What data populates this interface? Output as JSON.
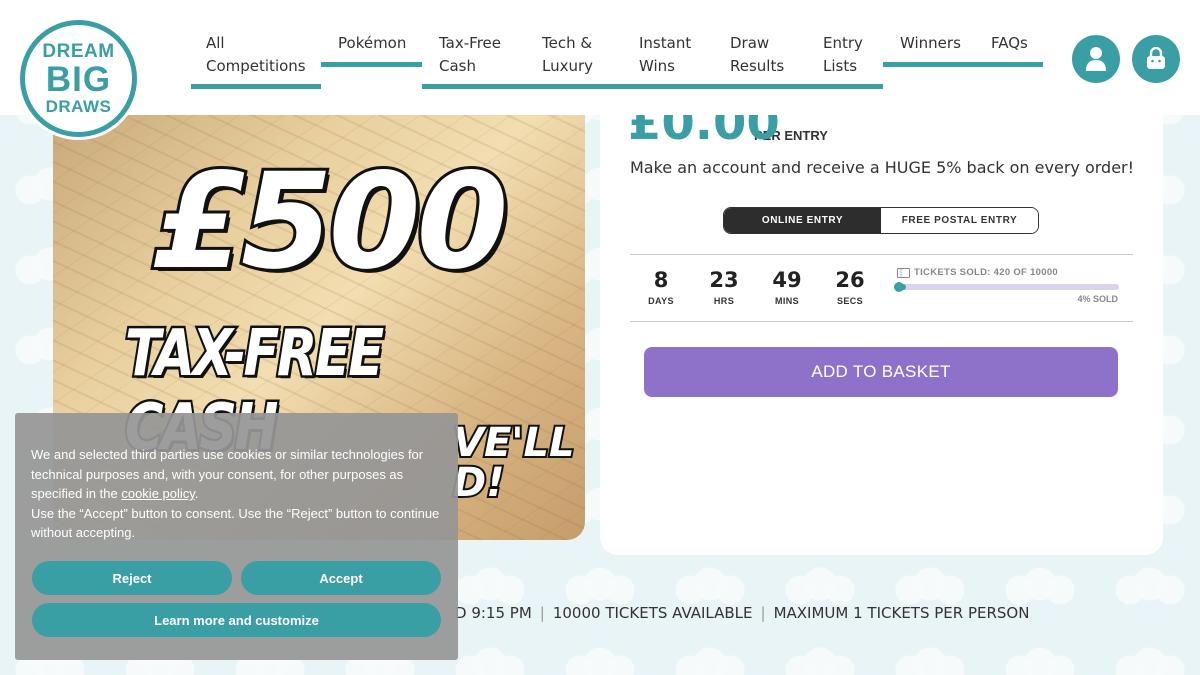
{
  "brand": {
    "line1": "DREAM",
    "line2": "BIG",
    "line3": "DRAWS"
  },
  "nav": {
    "items": [
      {
        "line1": "All",
        "line2": "Competitions"
      },
      {
        "line1": "Pokémon",
        "line2": ""
      },
      {
        "line1": "Tax-Free",
        "line2": "Cash"
      },
      {
        "line1": "Tech &",
        "line2": "Luxury"
      },
      {
        "line1": "Instant",
        "line2": "Wins"
      },
      {
        "line1": "Draw",
        "line2": "Results"
      },
      {
        "line1": "Entry",
        "line2": "Lists"
      },
      {
        "line1": "Winners",
        "line2": ""
      },
      {
        "line1": "FAQs",
        "line2": ""
      }
    ],
    "account_icon": "user-icon",
    "basket_icon": "shopping-bag-icon"
  },
  "product_image": {
    "amount": "£500",
    "caption": "TAX-FREE CASH",
    "partial_text_1": "VE'LL",
    "partial_text_2": "D!"
  },
  "product": {
    "price": "£0.00",
    "price_suffix": "PER ENTRY",
    "promo": "Make an account and receive a HUGE 5% back on every order!",
    "entry_tabs": {
      "online": "ONLINE ENTRY",
      "postal": "FREE POSTAL ENTRY"
    },
    "countdown": [
      {
        "value": "8",
        "unit": "DAYS"
      },
      {
        "value": "23",
        "unit": "HRS"
      },
      {
        "value": "49",
        "unit": "MINS"
      },
      {
        "value": "26",
        "unit": "SECS"
      }
    ],
    "tickets_sold_label": "TICKETS SOLD: 420 OF 10000",
    "sold_fraction": 0.042,
    "sold_pct_label": "4% SOLD",
    "add_to_basket": "ADD TO BASKET"
  },
  "info_line": {
    "draw_time": "D 9:15 PM",
    "tickets_available": "10000 TICKETS AVAILABLE",
    "max_per_person": "MAXIMUM 1 TICKETS PER PERSON"
  },
  "cookie_banner": {
    "text_before_link": "We and selected third parties use cookies or similar technologies for technical purposes and, with your consent, for other purposes as specified in the ",
    "link_text": "cookie policy",
    "text_after_link": ".",
    "line2": "Use the “Accept” button to consent. Use the “Reject” button to continue without accepting.",
    "reject": "Reject",
    "accept": "Accept",
    "learn_more": "Learn more and customize"
  },
  "colors": {
    "teal": "#3a9ea5",
    "purple": "#8e72c9",
    "dark": "#2d2d2d"
  }
}
